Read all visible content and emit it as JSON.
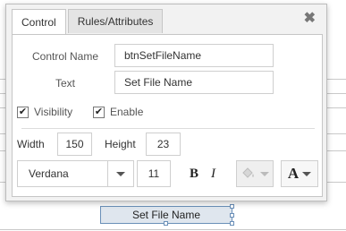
{
  "tabs": [
    {
      "label": "Control"
    },
    {
      "label": "Rules/Attributes"
    }
  ],
  "close_symbol": "✖",
  "control_name": {
    "label": "Control Name",
    "value": "btnSetFileName"
  },
  "text_field": {
    "label": "Text",
    "value": "Set File Name"
  },
  "visibility": {
    "label": "Visibility",
    "checked": true
  },
  "enable": {
    "label": "Enable",
    "checked": true
  },
  "width": {
    "label": "Width",
    "value": "150"
  },
  "height": {
    "label": "Height",
    "value": "23"
  },
  "font": {
    "family": "Verdana",
    "size": "11"
  },
  "format": {
    "bold": "B",
    "italic": "I",
    "font_color_symbol": "A"
  },
  "canvas_button_label": "Set File Name",
  "icons": [
    "close-icon",
    "paint-bucket-icon",
    "font-color-icon",
    "chevron-down-icon"
  ],
  "colors": {
    "tab_active": "#ffffff",
    "panel_bg": "#f2f2f2",
    "selection": "#6a8fb8"
  }
}
